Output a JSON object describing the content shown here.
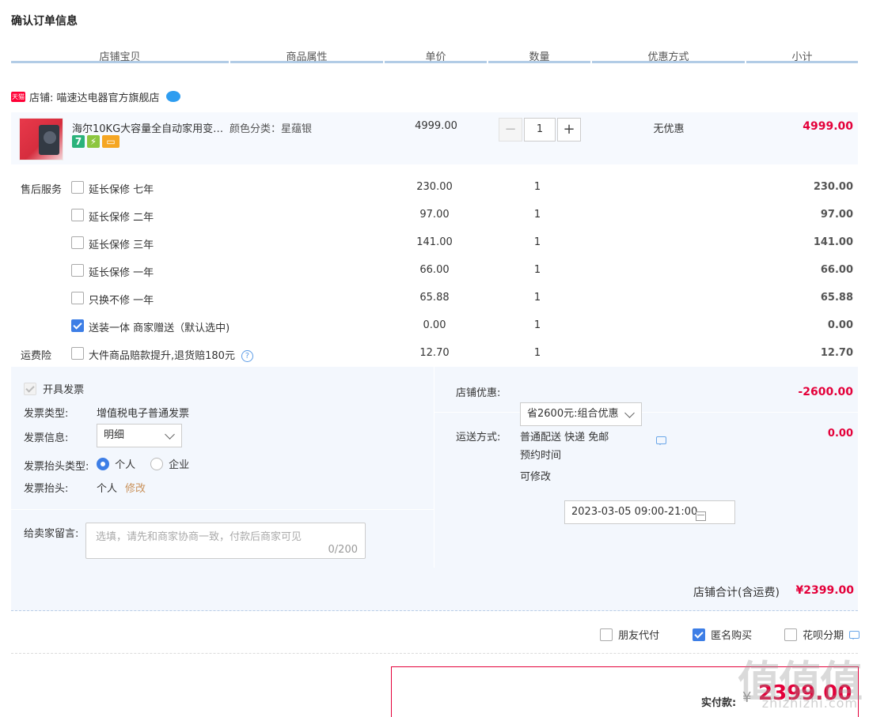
{
  "title": "确认订单信息",
  "columns": [
    "店铺宝贝",
    "商品属性",
    "单价",
    "数量",
    "优惠方式",
    "小计"
  ],
  "shop": {
    "tag": "天猫",
    "label": "店铺: 喵速达电器官方旗舰店"
  },
  "item": {
    "name": "海尔10KG大容量全自动家用变…",
    "attr": "颜色分类：星蕴银",
    "price": "4999.00",
    "qty": "1",
    "discount": "无优惠",
    "subtotal": "4999.00",
    "badges": [
      "7",
      "⚡",
      "▭"
    ]
  },
  "services": [
    {
      "label": "售后服务",
      "name": "延长保修 七年",
      "price": "230.00",
      "qty": "1",
      "subtotal": "230.00",
      "checked": false,
      "red": false
    },
    {
      "label": "",
      "name": "延长保修 二年",
      "price": "97.00",
      "qty": "1",
      "subtotal": "97.00",
      "checked": false,
      "red": false
    },
    {
      "label": "",
      "name": "延长保修 三年",
      "price": "141.00",
      "qty": "1",
      "subtotal": "141.00",
      "checked": false,
      "red": false
    },
    {
      "label": "",
      "name": "延长保修 一年",
      "price": "66.00",
      "qty": "1",
      "subtotal": "66.00",
      "checked": false,
      "red": false
    },
    {
      "label": "",
      "name": "只换不修 一年",
      "price": "65.88",
      "qty": "1",
      "subtotal": "65.88",
      "checked": false,
      "red": false
    },
    {
      "label": "",
      "name": "送装一体 商家赠送（默认选中)",
      "price": "0.00",
      "qty": "1",
      "subtotal": "0.00",
      "checked": true,
      "red": true
    },
    {
      "label": "运费险",
      "name": "大件商品赔款提升,退货赔180元",
      "price": "12.70",
      "qty": "1",
      "subtotal": "12.70",
      "checked": false,
      "red": false,
      "help": true
    }
  ],
  "invoice": {
    "open_label": "开具发票",
    "type_label": "发票类型:",
    "type_value": "增值税电子普通发票",
    "info_label": "发票信息:",
    "info_value": "明细",
    "header_type_label": "发票抬头类型:",
    "opt_personal": "个人",
    "opt_company": "企业",
    "header_label": "发票抬头:",
    "header_value": "个人",
    "modify": "修改"
  },
  "message": {
    "label": "给卖家留言:",
    "placeholder": "选填，请先和商家协商一致，付款后商家可见",
    "counter": "0/200"
  },
  "promo": {
    "label": "店铺优惠:",
    "value": "省2600元:组合优惠",
    "amount": "-2600.00"
  },
  "shipping": {
    "label": "运送方式:",
    "method": "普通配送 快递 免邮",
    "appoint_label": "预约时间",
    "appoint_value": "2023-03-05 09:00-21:00",
    "modifiable": "可修改",
    "fee": "0.00"
  },
  "total": {
    "label": "店铺合计(含运费)",
    "value": "¥2399.00"
  },
  "options": {
    "friend_pay": "朋友代付",
    "anonymous": "匿名购买",
    "installment": "花呗分期"
  },
  "pay": {
    "label": "实付款:",
    "symbol": "¥",
    "value": "2399.00"
  },
  "watermark": {
    "main": "值值值",
    "sub": "zhizhizhi.com"
  }
}
